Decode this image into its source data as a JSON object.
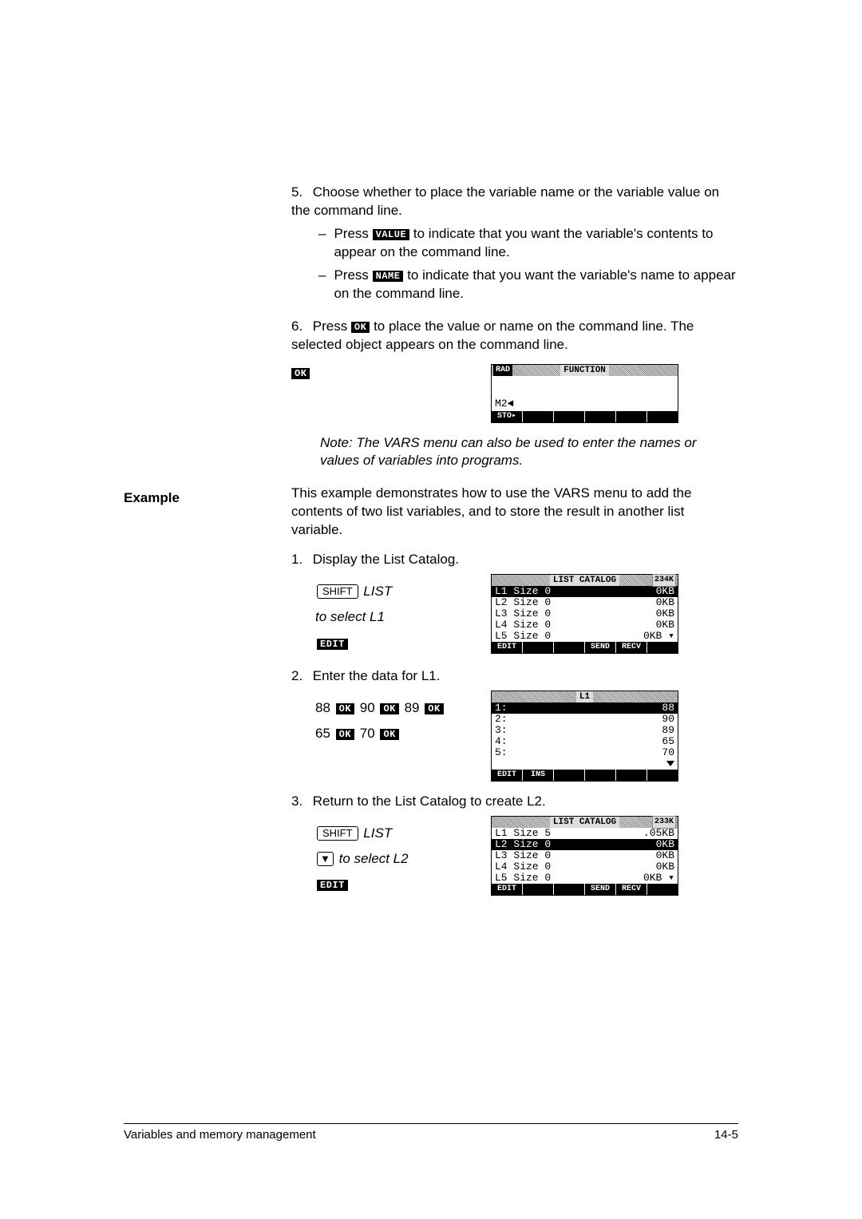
{
  "steps": {
    "s5": {
      "num": "5.",
      "text": "Choose whether to place the variable name or the variable value on the command line.",
      "a_prefix": "Press ",
      "a_key": "VALUE",
      "a_suffix": " to indicate that you want the variable's contents to appear on the command line.",
      "b_prefix": "Press ",
      "b_key": "NAME",
      "b_suffix": " to indicate that you want the variable's name to appear on the command line."
    },
    "s6": {
      "num": "6.",
      "prefix": "Press ",
      "key": "OK",
      "suffix": " to place the value or name on the command line. The selected object appears on the command line.",
      "lonekey": "OK"
    }
  },
  "note": "Note: The VARS menu can also be used to enter the names or values of variables into programs.",
  "example_heading": "Example",
  "example_intro": "This example demonstrates how to use the VARS menu to add the contents of two list variables, and to store the result in another list variable.",
  "ex": {
    "s1": {
      "num": "1.",
      "text": "Display the List Catalog.",
      "shift": "SHIFT",
      "list": "LIST",
      "sel": "to select L1",
      "edit": "EDIT"
    },
    "s2": {
      "num": "2.",
      "text": "Enter the data for L1.",
      "seq_nums": [
        "88",
        "90",
        "89",
        "65",
        "70"
      ],
      "ok": "OK"
    },
    "s3": {
      "num": "3.",
      "text": "Return to the List Catalog to create L2.",
      "shift": "SHIFT",
      "list": "LIST",
      "sel": "to select L2",
      "edit": "EDIT"
    }
  },
  "calc1": {
    "rad": "RAD",
    "title": "FUNCTION",
    "entry": "M2◄",
    "soft": [
      "STO▸",
      "",
      "",
      "",
      "",
      ""
    ]
  },
  "calc2": {
    "title": "LIST CATALOG",
    "mem": "234K",
    "rows": [
      {
        "l": "L1 Size 0",
        "r": "0KB",
        "sel": true
      },
      {
        "l": "L2 Size 0",
        "r": "0KB"
      },
      {
        "l": "L3 Size 0",
        "r": "0KB"
      },
      {
        "l": "L4 Size 0",
        "r": "0KB"
      },
      {
        "l": "L5 Size 0",
        "r": "0KB ▾"
      }
    ],
    "soft": [
      "EDIT",
      "",
      "",
      "SEND",
      "RECV",
      ""
    ]
  },
  "calc3": {
    "title": "L1",
    "rows": [
      {
        "l": "1:",
        "r": "88",
        "sel": true
      },
      {
        "l": "2:",
        "r": "90"
      },
      {
        "l": "3:",
        "r": "89"
      },
      {
        "l": "4:",
        "r": "65"
      },
      {
        "l": "5:",
        "r": "70"
      }
    ],
    "soft": [
      "EDIT",
      "INS",
      "",
      "",
      "",
      ""
    ]
  },
  "calc4": {
    "title": "LIST CATALOG",
    "mem": "233K",
    "rows": [
      {
        "l": "L1 Size 5",
        "r": ".05KB"
      },
      {
        "l": "L2 Size 0",
        "r": "0KB",
        "sel": true
      },
      {
        "l": "L3 Size 0",
        "r": "0KB"
      },
      {
        "l": "L4 Size 0",
        "r": "0KB"
      },
      {
        "l": "L5 Size 0",
        "r": "0KB ▾"
      }
    ],
    "soft": [
      "EDIT",
      "",
      "",
      "SEND",
      "RECV",
      ""
    ]
  },
  "footer": {
    "left": "Variables and memory management",
    "right": "14-5"
  },
  "glyph": {
    "down_arrow": "▼"
  }
}
